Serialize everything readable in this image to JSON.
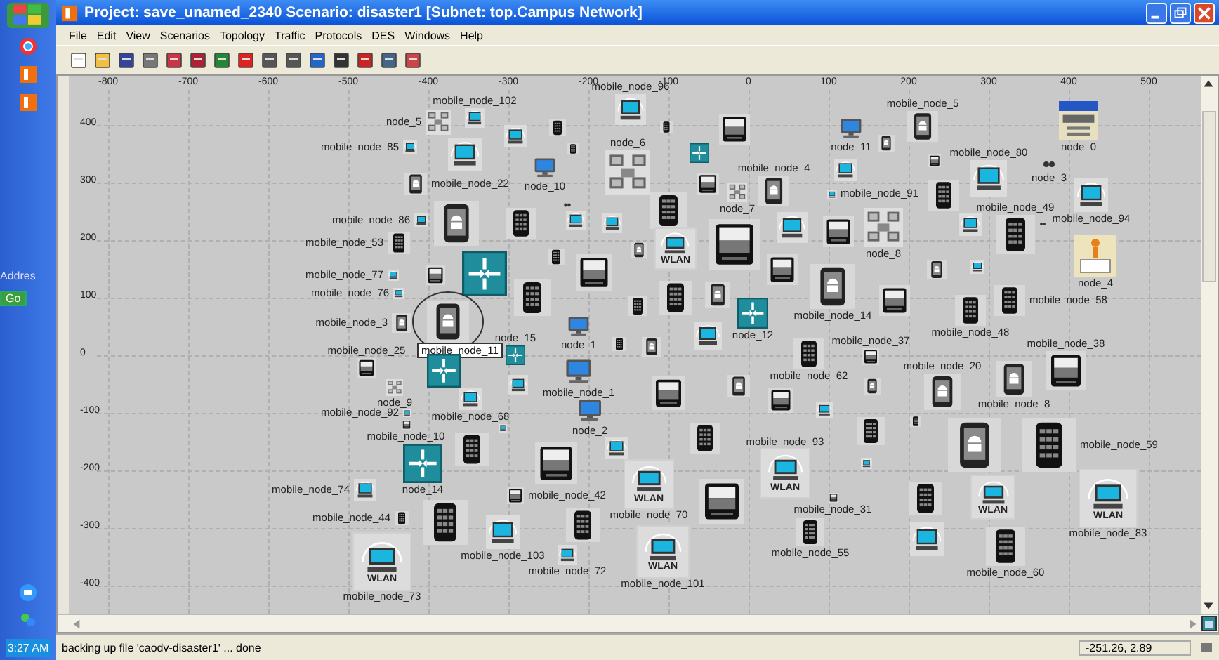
{
  "taskbar": {
    "address_label": "Addres",
    "go_button": "Go",
    "clock": "3:27 AM"
  },
  "window": {
    "title": "Project: save_unamed_2340 Scenario: disaster1  [Subnet: top.Campus Network]"
  },
  "menu": [
    "File",
    "Edit",
    "View",
    "Scenarios",
    "Topology",
    "Traffic",
    "Protocols",
    "DES",
    "Windows",
    "Help"
  ],
  "ruler": {
    "x_ticks": [
      "-800",
      "-700",
      "-600",
      "-500",
      "-400",
      "-300",
      "-200",
      "-100",
      "0",
      "100",
      "200",
      "300",
      "400",
      "500"
    ],
    "y_ticks": [
      "400",
      "300",
      "200",
      "100",
      "0",
      "-100",
      "-200",
      "-300",
      "-400"
    ]
  },
  "nodes": [
    {
      "label": "node_5",
      "kind": "hub",
      "selected": false
    },
    {
      "label": "mobile_node_102",
      "kind": "wlan",
      "selected": false
    },
    {
      "kind": "wlan",
      "selected": false
    },
    {
      "kind": "phone",
      "selected": false
    },
    {
      "kind": "phone",
      "selected": false
    },
    {
      "label": "mobile_node_85",
      "kind": "wlan",
      "selected": false
    },
    {
      "kind": "wlan",
      "selected": false
    },
    {
      "label": "node_10",
      "kind": "laptop",
      "selected": false
    },
    {
      "label": "mobile_node_96",
      "kind": "wlan",
      "selected": false
    },
    {
      "label": "node_6",
      "kind": "hub",
      "selected": false
    },
    {
      "kind": "phone",
      "selected": false
    },
    {
      "kind": "tablet",
      "selected": false
    },
    {
      "kind": "router",
      "selected": false
    },
    {
      "label": "node_11",
      "kind": "laptop",
      "selected": false
    },
    {
      "kind": "android",
      "selected": false
    },
    {
      "label": "mobile_node_5",
      "kind": "android",
      "selected": false
    },
    {
      "label": "node_0",
      "kind": "ip",
      "selected": false
    },
    {
      "kind": "tablet",
      "selected": false
    },
    {
      "label": "mobile_node_80",
      "kind": "wlan",
      "selected": false
    },
    {
      "label": "node_3",
      "kind": "dots",
      "selected": false
    },
    {
      "label": "mobile_node_94",
      "kind": "wlan",
      "selected": false
    },
    {
      "label": "mobile_node_22",
      "kind": "android",
      "selected": false
    },
    {
      "kind": "dots",
      "selected": false
    },
    {
      "label": "mobile_node_86",
      "kind": "wlan",
      "selected": false
    },
    {
      "kind": "android",
      "selected": false
    },
    {
      "kind": "phone",
      "selected": false
    },
    {
      "kind": "wlan",
      "selected": false
    },
    {
      "kind": "wlan",
      "selected": false
    },
    {
      "label": "mobile_node_53",
      "kind": "phone",
      "selected": false
    },
    {
      "kind": "router",
      "selected": false
    },
    {
      "kind": "phone",
      "selected": false
    },
    {
      "kind": "tablet",
      "selected": false
    },
    {
      "kind": "android",
      "selected": false
    },
    {
      "label": "mobile_node_77",
      "kind": "wlan",
      "selected": false
    },
    {
      "kind": "tablet",
      "selected": false
    },
    {
      "label": "mobile_node_76",
      "kind": "wlan",
      "selected": false
    },
    {
      "kind": "phone",
      "selected": false
    },
    {
      "kind": "phone",
      "selected": false
    },
    {
      "label": "mobile_node_3",
      "kind": "android",
      "selected": false
    },
    {
      "label": "mobile_node_11",
      "kind": "android",
      "selected": true
    },
    {
      "label": "node_15",
      "kind": "router",
      "selected": false
    },
    {
      "label": "node_1",
      "kind": "laptop",
      "selected": false
    },
    {
      "kind": "phone",
      "selected": false
    },
    {
      "label": "mobile_node_25",
      "kind": "tablet",
      "selected": false
    },
    {
      "kind": "router",
      "selected": false
    },
    {
      "kind": "wlan",
      "selected": false
    },
    {
      "label": "node_9",
      "kind": "hub",
      "selected": false
    },
    {
      "label": "mobile_node_1",
      "kind": "laptop",
      "selected": false
    },
    {
      "label": "mobile_node_92",
      "kind": "wlan",
      "selected": false
    },
    {
      "label": "mobile_node_68",
      "kind": "wlan",
      "selected": false
    },
    {
      "label": "node_2",
      "kind": "laptop",
      "selected": false
    },
    {
      "label": "mobile_node_10",
      "kind": "tablet",
      "selected": false
    },
    {
      "kind": "wlan",
      "selected": false
    },
    {
      "kind": "phone",
      "selected": false
    },
    {
      "label": "mobile_node_74",
      "kind": "wlan",
      "selected": false
    },
    {
      "kind": "tablet",
      "selected": false
    },
    {
      "kind": "wlan",
      "selected": false
    },
    {
      "label": "node_14",
      "kind": "router",
      "selected": false
    },
    {
      "label": "mobile_node_42",
      "kind": "tablet",
      "selected": false
    },
    {
      "label": "mobile_node_44",
      "kind": "phone",
      "selected": false
    },
    {
      "kind": "phone",
      "selected": false
    },
    {
      "label": "mobile_node_103",
      "kind": "wlan",
      "selected": false
    },
    {
      "kind": "phone",
      "selected": false
    },
    {
      "label": "mobile_node_72",
      "kind": "wlan",
      "selected": false
    },
    {
      "label": "mobile_node_73",
      "kind": "wlan",
      "badge": "WLAN",
      "selected": false
    },
    {
      "label": "mobile_node_70",
      "kind": "wlan",
      "badge": "WLAN",
      "selected": false
    },
    {
      "label": "mobile_node_101",
      "kind": "wlan",
      "badge": "WLAN",
      "selected": false
    },
    {
      "kind": "phone",
      "selected": false
    },
    {
      "kind": "wlan",
      "badge": "WLAN",
      "selected": false
    },
    {
      "kind": "tablet",
      "selected": false
    },
    {
      "label": "mobile_node_4",
      "kind": "android",
      "selected": false
    },
    {
      "kind": "tablet",
      "selected": false
    },
    {
      "label": "node_7",
      "kind": "hub",
      "selected": false
    },
    {
      "kind": "wlan",
      "selected": false
    },
    {
      "label": "mobile_node_91",
      "kind": "wlan",
      "selected": false
    },
    {
      "kind": "phone",
      "selected": false
    },
    {
      "kind": "wlan",
      "selected": false
    },
    {
      "kind": "tablet",
      "selected": false
    },
    {
      "label": "node_8",
      "kind": "hub",
      "selected": false
    },
    {
      "kind": "wlan",
      "selected": false
    },
    {
      "label": "mobile_node_49",
      "kind": "phone",
      "selected": false
    },
    {
      "kind": "dots",
      "selected": false
    },
    {
      "label": "node_4",
      "kind": "config",
      "selected": false
    },
    {
      "kind": "tablet",
      "selected": false
    },
    {
      "label": "mobile_node_14",
      "kind": "android",
      "selected": false
    },
    {
      "kind": "android",
      "selected": false
    },
    {
      "kind": "wlan",
      "selected": false
    },
    {
      "label": "mobile_node_58",
      "kind": "phone",
      "selected": false
    },
    {
      "kind": "phone",
      "selected": false
    },
    {
      "kind": "android",
      "selected": false
    },
    {
      "label": "node_12",
      "kind": "router",
      "selected": false
    },
    {
      "kind": "tablet",
      "selected": false
    },
    {
      "label": "mobile_node_48",
      "kind": "phone",
      "selected": false
    },
    {
      "kind": "wlan",
      "selected": false
    },
    {
      "kind": "android",
      "selected": false
    },
    {
      "label": "mobile_node_37",
      "kind": "tablet",
      "selected": false
    },
    {
      "label": "mobile_node_38",
      "kind": "tablet",
      "selected": false
    },
    {
      "label": "mobile_node_62",
      "kind": "phone",
      "selected": false
    },
    {
      "label": "mobile_node_20",
      "kind": "android",
      "selected": false
    },
    {
      "label": "mobile_node_8",
      "kind": "android",
      "selected": false
    },
    {
      "kind": "tablet",
      "selected": false
    },
    {
      "kind": "android",
      "selected": false
    },
    {
      "kind": "tablet",
      "selected": false
    },
    {
      "kind": "wlan",
      "selected": false
    },
    {
      "kind": "android",
      "selected": false
    },
    {
      "kind": "phone",
      "selected": false
    },
    {
      "kind": "phone",
      "selected": false
    },
    {
      "kind": "phone",
      "selected": false
    },
    {
      "label": "mobile_node_93",
      "kind": "wlan",
      "badge": "WLAN",
      "selected": false
    },
    {
      "kind": "android",
      "selected": false
    },
    {
      "label": "mobile_node_59",
      "kind": "phone",
      "selected": false
    },
    {
      "kind": "wlan",
      "selected": false
    },
    {
      "kind": "tablet",
      "selected": false
    },
    {
      "label": "mobile_node_31",
      "kind": "tablet",
      "selected": false
    },
    {
      "kind": "phone",
      "selected": false
    },
    {
      "kind": "wlan",
      "badge": "WLAN",
      "selected": false
    },
    {
      "label": "mobile_node_83",
      "kind": "wlan",
      "badge": "WLAN",
      "selected": false
    },
    {
      "label": "mobile_node_55",
      "kind": "phone",
      "selected": false
    },
    {
      "kind": "wlan",
      "selected": false
    },
    {
      "label": "mobile_node_60",
      "kind": "phone",
      "selected": false
    }
  ],
  "status_bar": {
    "message": "backing up file 'caodv-disaster1' ... done",
    "coordinates": "-251.26, 2.89"
  }
}
